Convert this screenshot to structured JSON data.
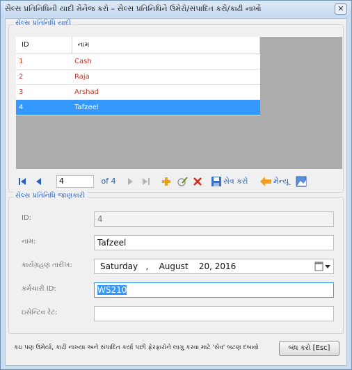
{
  "window": {
    "title": "સેલ્સ પ્રતિનિધિની યાદી મેનેજ કરો – સેલ્સ પ્રતિનિધિને ઉમેરો/સંપાદિત કરો/કાઢી નાખો",
    "close_label": "✕"
  },
  "grid_group": {
    "title": "સેલ્સ પ્રતિનિધિ યાદી",
    "columns": [
      "ID",
      "નામ"
    ],
    "rows": [
      {
        "id": "1",
        "name": "Cash"
      },
      {
        "id": "2",
        "name": "Raja"
      },
      {
        "id": "3",
        "name": "Arshad"
      },
      {
        "id": "4",
        "name": "Tafzeel"
      }
    ],
    "selected_index": 3
  },
  "navigator": {
    "position": "4",
    "of_total": "of 4",
    "save_label": "સેવ કરો",
    "menu_label": "મેન્યૂ"
  },
  "details_group": {
    "title": "સેલ્સ પ્રતિનિધિ જાણકારી",
    "fields": {
      "id_label": "ID:",
      "id_value": "4",
      "name_label": "નામ:",
      "name_value": "Tafzeel",
      "join_label": "કાર્યગ્રહણ તારીખ:",
      "join_value": "Saturday   ,    August    20, 2016",
      "emp_label": "કર્મચારી ID:",
      "emp_value": "WS210",
      "rate_label": "ઇસેન્ટિવ રેટ:",
      "rate_value": ""
    }
  },
  "footer": {
    "note": "કઇ પણ ઉમેર્યા, કાઢી નાખ્યા અને સંપાદિત કર્યા પછી ફેરફારોને લાગુ કરવા માટે 'સેવ' બટણ દબાવો",
    "close_button": "બંધ કરો [Esc]"
  }
}
